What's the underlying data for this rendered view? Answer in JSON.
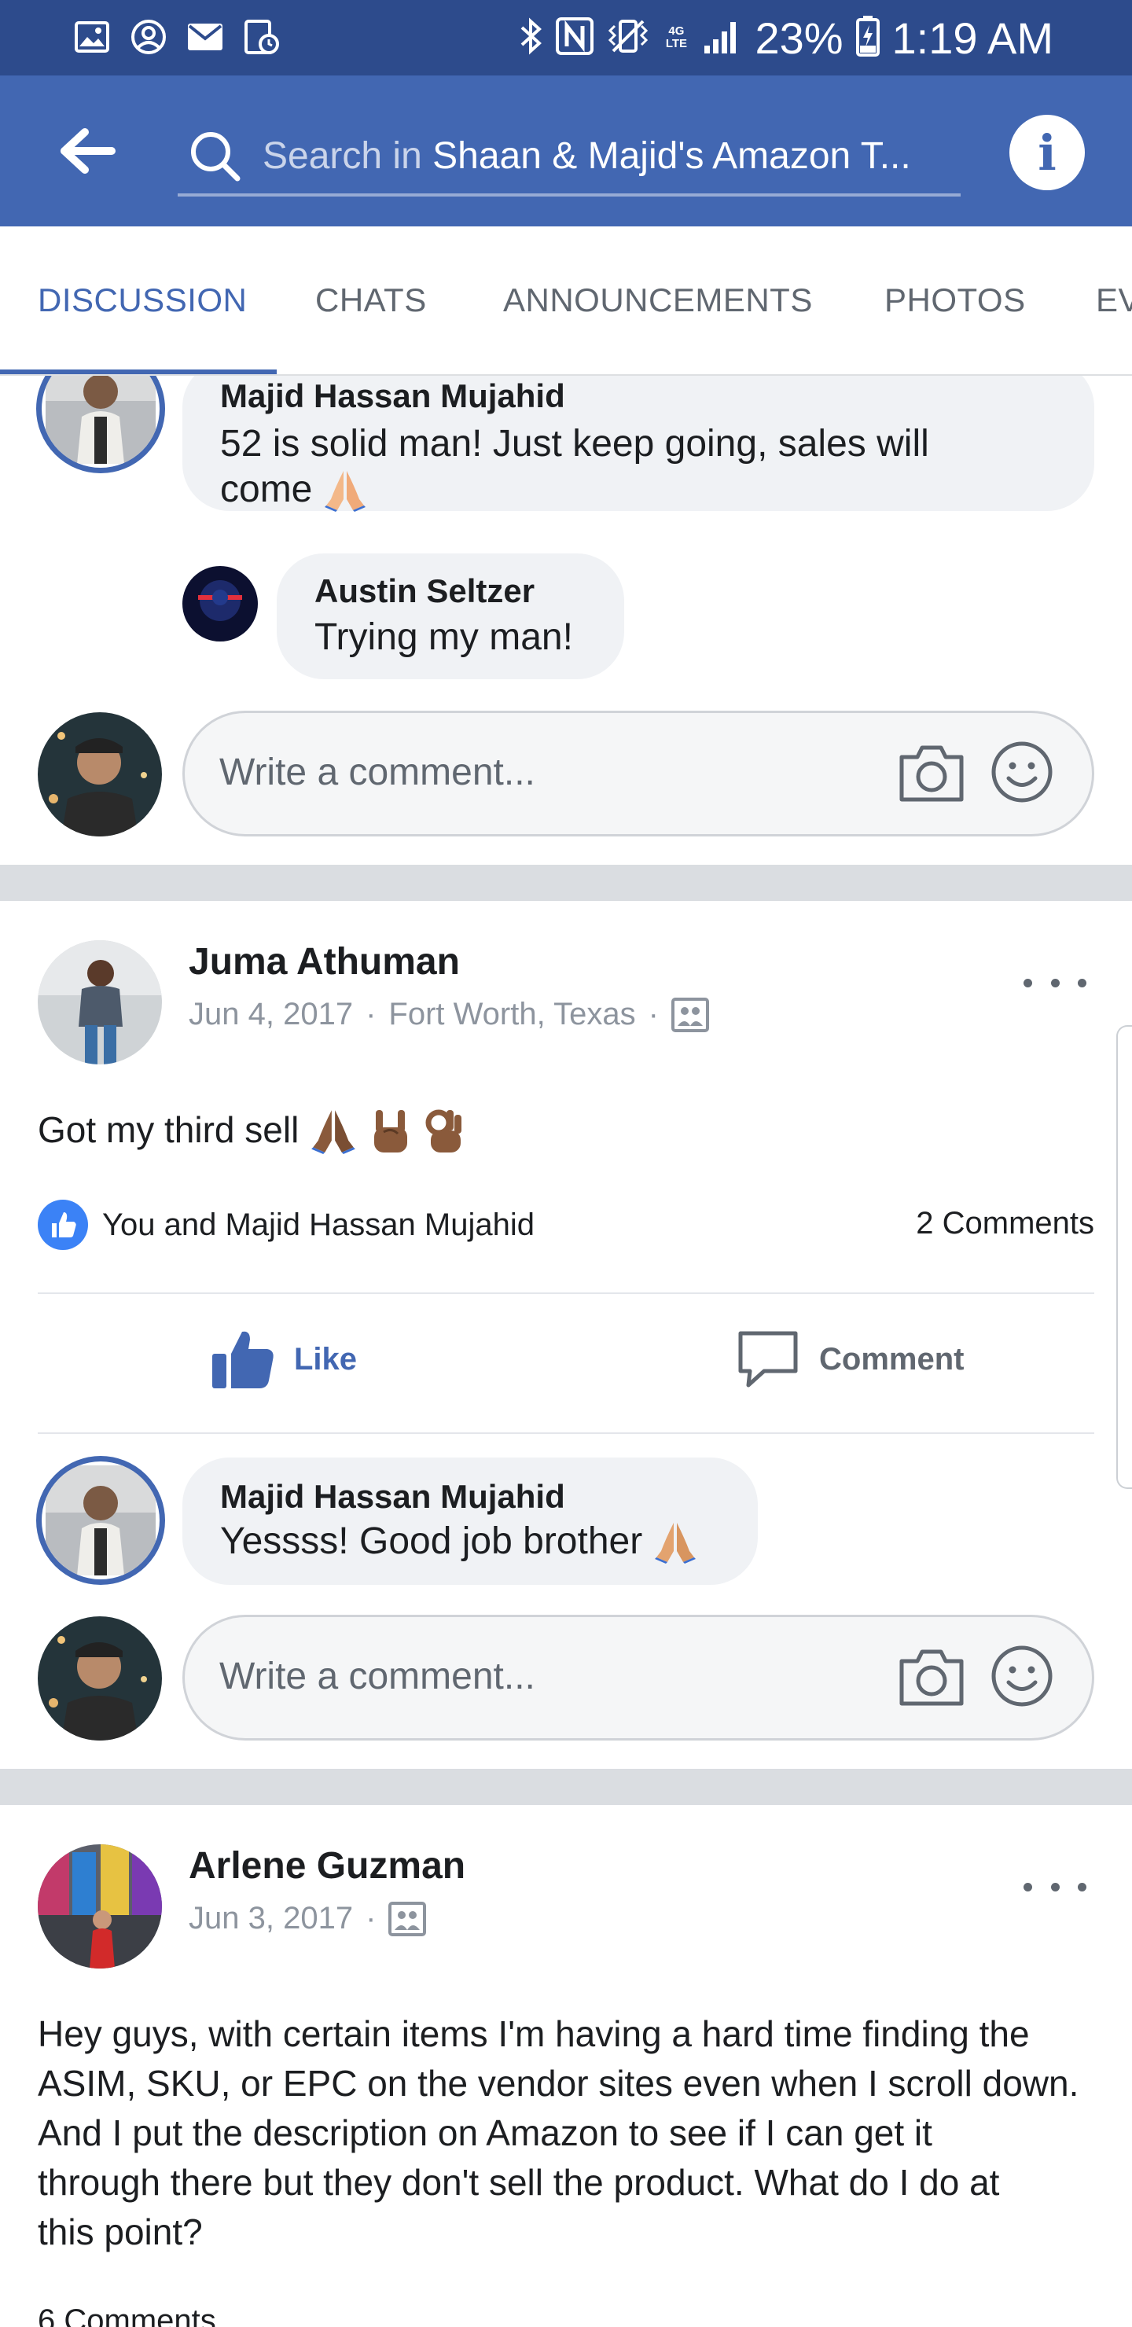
{
  "status_bar": {
    "network_label": "4G LTE",
    "battery": "23%",
    "time": "1:19 AM"
  },
  "header": {
    "search_prefix": "Search in ",
    "search_group": "Shaan & Majid's Amazon T...",
    "info_label": "i"
  },
  "tabs": [
    {
      "label": "DISCUSSION",
      "active": true
    },
    {
      "label": "CHATS",
      "active": false
    },
    {
      "label": "ANNOUNCEMENTS",
      "active": false
    },
    {
      "label": "PHOTOS",
      "active": false
    },
    {
      "label": "EV",
      "active": false
    }
  ],
  "thread1": {
    "comment1": {
      "author": "Majid Hassan Mujahid",
      "line1": "52 is solid man! Just keep going, sales will",
      "line2": "come"
    },
    "reply1": {
      "author": "Austin Seltzer",
      "text": "Trying my man!"
    },
    "write_placeholder": "Write a comment..."
  },
  "post1": {
    "author": "Juma Athuman",
    "date": "Jun 4, 2017",
    "location": "Fort Worth, Texas",
    "body": "Got my third sell",
    "reactions_text": "You and Majid Hassan Mujahid",
    "comments_count": "2 Comments",
    "like_label": "Like",
    "comment_label": "Comment",
    "comment1": {
      "author": "Majid Hassan Mujahid",
      "text": "Yessss! Good job brother"
    },
    "write_placeholder": "Write a comment..."
  },
  "post2": {
    "author": "Arlene Guzman",
    "date": "Jun 3, 2017",
    "body_lines": [
      "Hey guys, with certain items I'm having a hard time finding the",
      "ASIM, SKU, or EPC on the vendor sites even when I scroll down.",
      "And I put the description on Amazon to see if I can get it",
      "through there but they don't sell the product. What do I do at",
      "this point?"
    ],
    "comments_count": "6 Comments"
  },
  "colors": {
    "brand": "#4267b2",
    "status_bar": "#2d4b8c",
    "bubble": "#f0f2f5",
    "divider": "#dadde1"
  },
  "icons": [
    "gallery-icon",
    "account-icon",
    "mail-icon",
    "screen-record-icon",
    "bluetooth-icon",
    "nfc-icon",
    "vibrate-icon",
    "signal-icon",
    "battery-icon",
    "back-arrow-icon",
    "search-icon",
    "info-icon",
    "camera-icon",
    "smiley-icon",
    "thumbs-up-icon",
    "comment-bubble-icon",
    "photo-album-icon",
    "more-icon",
    "folded-hands-emoji",
    "rock-on-emoji",
    "ok-hand-emoji"
  ]
}
